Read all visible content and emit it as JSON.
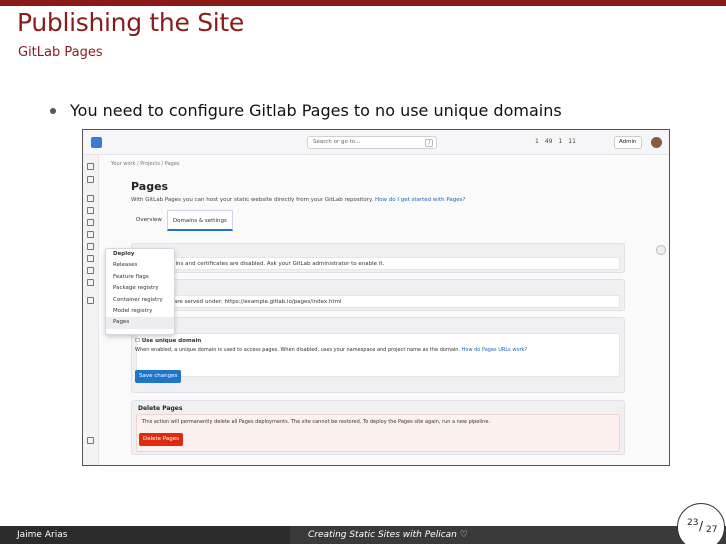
{
  "slide": {
    "title": "Publishing the Site",
    "subtitle": "GitLab Pages",
    "bullet": "You need to configure Gitlab Pages to no use unique domains"
  },
  "screenshot": {
    "search_placeholder": "Search or go to...",
    "search_shortcut": "/",
    "header_counts": [
      "1",
      "49",
      "1",
      "11"
    ],
    "admin_label": "Admin",
    "breadcrumb": "Your work / Projects / Pages",
    "page_heading": "Pages",
    "page_description": "With GitLab Pages you can host your static website directly from your GitLab repository.",
    "page_description_link": "How do I get started with Pages?",
    "tabs": [
      "Overview",
      "Domains & settings"
    ],
    "active_tab": "Domains & settings",
    "card1_text": "Pages domains and certificates are disabled. Ask your GitLab administrator to enable it.",
    "card2_text": "Your pages are served under: https://example.gitlab.io/pages/index.html",
    "menu_items": [
      "Deploy",
      "Releases",
      "Feature flags",
      "Package registry",
      "Container registry",
      "Model registry",
      "Pages"
    ],
    "menu_selected": "Pages",
    "unique_checkbox_label": "Use unique domain",
    "unique_help": "When enabled, a unique domain is used to access pages. When disabled, uses your namespace and project name as the domain.",
    "unique_help_link": "How do Pages URLs work?",
    "save_label": "Save changes",
    "delete_title": "Delete Pages",
    "delete_text": "This action will permanently delete all Pages deployments. The site cannot be restored. To deploy the Pages site again, run a new pipeline.",
    "delete_button": "Delete Pages"
  },
  "footer": {
    "author": "Jaime Arias",
    "talk": "Creating Static Sites with Pelican ♡",
    "page_current": "23",
    "page_total": "27"
  },
  "colors": {
    "accent": "#8b1a1a",
    "blue": "#1f75cb",
    "danger": "#dd2b0e"
  }
}
